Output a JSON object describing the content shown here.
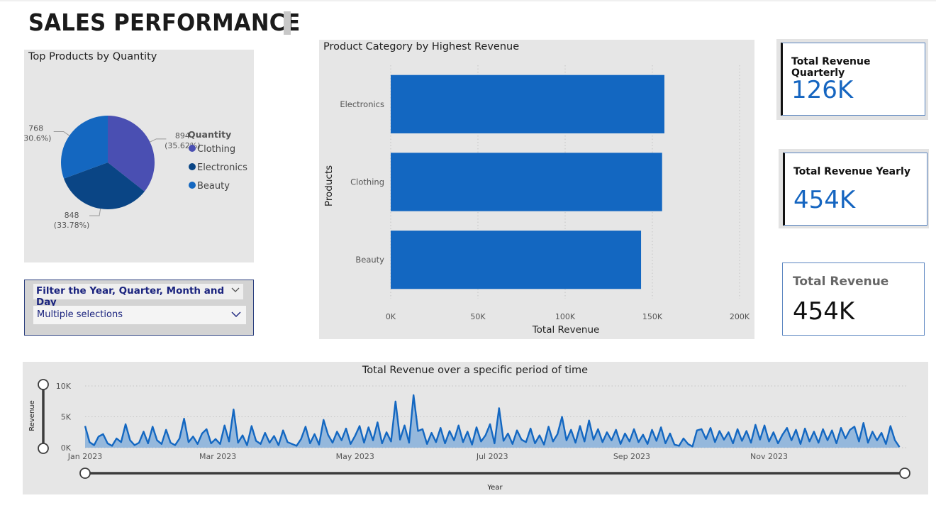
{
  "page_title": "SALES PERFORMANCE",
  "colors": {
    "bar": "#1367c1",
    "pie": [
      "#4a4fb2",
      "#0a4585",
      "#1467c0"
    ],
    "card_value": "#1565c0",
    "panel": "#e6e6e6"
  },
  "slicer": {
    "header": "Filter the Year, Quarter, Month and Day",
    "value": "Multiple selections",
    "icon": "chevron-down-icon"
  },
  "cards": {
    "quarterly": {
      "label": "Total Revenue Quarterly",
      "value": "126K"
    },
    "yearly": {
      "label": "Total Revenue Yearly",
      "value": "454K"
    },
    "total": {
      "label": "Total Revenue",
      "value": "454K"
    }
  },
  "chart_data": [
    {
      "type": "pie",
      "title": "Top Products by Quantity",
      "legend_title": "Quantity",
      "legend_position": "right",
      "slices": [
        {
          "name": "Clothing",
          "value": 894,
          "percent": "35.62%",
          "label": "894",
          "label_pct": "(35.62%)"
        },
        {
          "name": "Electronics",
          "value": 848,
          "percent": "33.78%",
          "label": "848",
          "label_pct": "(33.78%)"
        },
        {
          "name": "Beauty",
          "value": 768,
          "percent": "30.6%",
          "label": "768",
          "label_pct": "(30.6%)"
        }
      ]
    },
    {
      "type": "bar",
      "orientation": "horizontal",
      "title": "Product Category by Highest Revenue",
      "xlabel": "Total Revenue",
      "ylabel": "Products",
      "categories": [
        "Electronics",
        "Clothing",
        "Beauty"
      ],
      "values": [
        156905,
        155580,
        143515
      ],
      "xlim": [
        0,
        200000
      ],
      "xticks": [
        "0K",
        "50K",
        "100K",
        "150K",
        "200K"
      ],
      "grid": true
    },
    {
      "type": "area",
      "title": "Total Revenue over a specific period of time",
      "xlabel": "Year",
      "ylabel": "Revenue",
      "ylim": [
        0,
        10000
      ],
      "yticks": [
        "0K",
        "5K",
        "10K"
      ],
      "xticks": [
        "Jan 2023",
        "Mar 2023",
        "May 2023",
        "Jul 2023",
        "Sep 2023",
        "Nov 2023"
      ],
      "x_start": "2023-01-01",
      "x_end": "2024-01-01",
      "grid": true,
      "points": [
        [
          "2023-01-01",
          3500
        ],
        [
          "2023-01-03",
          900
        ],
        [
          "2023-01-05",
          400
        ],
        [
          "2023-01-07",
          1800
        ],
        [
          "2023-01-09",
          2200
        ],
        [
          "2023-01-11",
          700
        ],
        [
          "2023-01-13",
          300
        ],
        [
          "2023-01-15",
          1500
        ],
        [
          "2023-01-17",
          900
        ],
        [
          "2023-01-19",
          3800
        ],
        [
          "2023-01-21",
          1200
        ],
        [
          "2023-01-23",
          400
        ],
        [
          "2023-01-25",
          800
        ],
        [
          "2023-01-27",
          2600
        ],
        [
          "2023-01-29",
          700
        ],
        [
          "2023-01-31",
          3400
        ],
        [
          "2023-02-02",
          1200
        ],
        [
          "2023-02-04",
          600
        ],
        [
          "2023-02-06",
          2900
        ],
        [
          "2023-02-08",
          800
        ],
        [
          "2023-02-10",
          400
        ],
        [
          "2023-02-12",
          1500
        ],
        [
          "2023-02-14",
          4700
        ],
        [
          "2023-02-16",
          900
        ],
        [
          "2023-02-18",
          1800
        ],
        [
          "2023-02-20",
          600
        ],
        [
          "2023-02-22",
          2300
        ],
        [
          "2023-02-24",
          3000
        ],
        [
          "2023-02-26",
          700
        ],
        [
          "2023-02-28",
          1400
        ],
        [
          "2023-03-02",
          600
        ],
        [
          "2023-03-04",
          3600
        ],
        [
          "2023-03-06",
          1000
        ],
        [
          "2023-03-08",
          6200
        ],
        [
          "2023-03-10",
          800
        ],
        [
          "2023-03-12",
          2000
        ],
        [
          "2023-03-14",
          400
        ],
        [
          "2023-03-16",
          3500
        ],
        [
          "2023-03-18",
          1100
        ],
        [
          "2023-03-20",
          600
        ],
        [
          "2023-03-22",
          2400
        ],
        [
          "2023-03-24",
          800
        ],
        [
          "2023-03-26",
          1900
        ],
        [
          "2023-03-28",
          400
        ],
        [
          "2023-03-30",
          2800
        ],
        [
          "2023-04-01",
          900
        ],
        [
          "2023-04-03",
          600
        ],
        [
          "2023-04-05",
          300
        ],
        [
          "2023-04-07",
          1400
        ],
        [
          "2023-04-09",
          3400
        ],
        [
          "2023-04-11",
          700
        ],
        [
          "2023-04-13",
          2200
        ],
        [
          "2023-04-15",
          500
        ],
        [
          "2023-04-17",
          4500
        ],
        [
          "2023-04-19",
          2100
        ],
        [
          "2023-04-21",
          800
        ],
        [
          "2023-04-23",
          2600
        ],
        [
          "2023-04-25",
          1200
        ],
        [
          "2023-04-27",
          3100
        ],
        [
          "2023-04-29",
          600
        ],
        [
          "2023-05-01",
          1900
        ],
        [
          "2023-05-03",
          3500
        ],
        [
          "2023-05-05",
          800
        ],
        [
          "2023-05-07",
          3300
        ],
        [
          "2023-05-09",
          1200
        ],
        [
          "2023-05-11",
          4100
        ],
        [
          "2023-05-13",
          700
        ],
        [
          "2023-05-15",
          2500
        ],
        [
          "2023-05-17",
          1000
        ],
        [
          "2023-05-19",
          7500
        ],
        [
          "2023-05-21",
          1300
        ],
        [
          "2023-05-23",
          3600
        ],
        [
          "2023-05-25",
          800
        ],
        [
          "2023-05-27",
          8500
        ],
        [
          "2023-05-29",
          2700
        ],
        [
          "2023-05-31",
          3000
        ],
        [
          "2023-06-02",
          600
        ],
        [
          "2023-06-04",
          2400
        ],
        [
          "2023-06-06",
          900
        ],
        [
          "2023-06-08",
          3200
        ],
        [
          "2023-06-10",
          700
        ],
        [
          "2023-06-12",
          2700
        ],
        [
          "2023-06-14",
          1200
        ],
        [
          "2023-06-16",
          3600
        ],
        [
          "2023-06-18",
          900
        ],
        [
          "2023-06-20",
          2600
        ],
        [
          "2023-06-22",
          500
        ],
        [
          "2023-06-24",
          3300
        ],
        [
          "2023-06-26",
          1000
        ],
        [
          "2023-06-28",
          2000
        ],
        [
          "2023-06-30",
          3800
        ],
        [
          "2023-07-02",
          700
        ],
        [
          "2023-07-04",
          6400
        ],
        [
          "2023-07-06",
          1100
        ],
        [
          "2023-07-08",
          2300
        ],
        [
          "2023-07-10",
          600
        ],
        [
          "2023-07-12",
          2800
        ],
        [
          "2023-07-14",
          1300
        ],
        [
          "2023-07-16",
          900
        ],
        [
          "2023-07-18",
          3100
        ],
        [
          "2023-07-20",
          700
        ],
        [
          "2023-07-22",
          2000
        ],
        [
          "2023-07-24",
          500
        ],
        [
          "2023-07-26",
          3400
        ],
        [
          "2023-07-28",
          1000
        ],
        [
          "2023-07-30",
          2200
        ],
        [
          "2023-08-01",
          5000
        ],
        [
          "2023-08-03",
          1200
        ],
        [
          "2023-08-05",
          2900
        ],
        [
          "2023-08-07",
          800
        ],
        [
          "2023-08-09",
          3500
        ],
        [
          "2023-08-11",
          1000
        ],
        [
          "2023-08-13",
          4400
        ],
        [
          "2023-08-15",
          1300
        ],
        [
          "2023-08-17",
          3000
        ],
        [
          "2023-08-19",
          900
        ],
        [
          "2023-08-21",
          2500
        ],
        [
          "2023-08-23",
          1200
        ],
        [
          "2023-08-25",
          2900
        ],
        [
          "2023-08-27",
          600
        ],
        [
          "2023-08-29",
          2300
        ],
        [
          "2023-08-31",
          1000
        ],
        [
          "2023-09-02",
          3000
        ],
        [
          "2023-09-04",
          900
        ],
        [
          "2023-09-06",
          2100
        ],
        [
          "2023-09-08",
          600
        ],
        [
          "2023-09-10",
          2900
        ],
        [
          "2023-09-12",
          1100
        ],
        [
          "2023-09-14",
          3300
        ],
        [
          "2023-09-16",
          700
        ],
        [
          "2023-09-18",
          2300
        ],
        [
          "2023-09-20",
          500
        ],
        [
          "2023-09-22",
          300
        ],
        [
          "2023-09-24",
          1500
        ],
        [
          "2023-09-26",
          600
        ],
        [
          "2023-09-28",
          200
        ],
        [
          "2023-09-30",
          2800
        ],
        [
          "2023-10-02",
          3000
        ],
        [
          "2023-10-04",
          1400
        ],
        [
          "2023-10-06",
          3200
        ],
        [
          "2023-10-08",
          900
        ],
        [
          "2023-10-10",
          2700
        ],
        [
          "2023-10-12",
          1300
        ],
        [
          "2023-10-14",
          2500
        ],
        [
          "2023-10-16",
          700
        ],
        [
          "2023-10-18",
          3000
        ],
        [
          "2023-10-20",
          1100
        ],
        [
          "2023-10-22",
          2700
        ],
        [
          "2023-10-24",
          800
        ],
        [
          "2023-10-26",
          3700
        ],
        [
          "2023-10-28",
          1300
        ],
        [
          "2023-10-30",
          3600
        ],
        [
          "2023-11-01",
          1000
        ],
        [
          "2023-11-03",
          2500
        ],
        [
          "2023-11-05",
          700
        ],
        [
          "2023-11-07",
          2100
        ],
        [
          "2023-11-09",
          3200
        ],
        [
          "2023-11-11",
          1200
        ],
        [
          "2023-11-13",
          2900
        ],
        [
          "2023-11-15",
          600
        ],
        [
          "2023-11-17",
          3100
        ],
        [
          "2023-11-19",
          1000
        ],
        [
          "2023-11-21",
          2600
        ],
        [
          "2023-11-23",
          800
        ],
        [
          "2023-11-25",
          3000
        ],
        [
          "2023-11-27",
          1200
        ],
        [
          "2023-11-29",
          2800
        ],
        [
          "2023-12-01",
          700
        ],
        [
          "2023-12-03",
          3200
        ],
        [
          "2023-12-05",
          1500
        ],
        [
          "2023-12-07",
          2900
        ],
        [
          "2023-12-09",
          3400
        ],
        [
          "2023-12-11",
          1000
        ],
        [
          "2023-12-13",
          4000
        ],
        [
          "2023-12-15",
          800
        ],
        [
          "2023-12-17",
          2600
        ],
        [
          "2023-12-19",
          1200
        ],
        [
          "2023-12-21",
          2400
        ],
        [
          "2023-12-23",
          600
        ],
        [
          "2023-12-25",
          3500
        ],
        [
          "2023-12-27",
          1200
        ],
        [
          "2023-12-29",
          100
        ]
      ]
    }
  ]
}
